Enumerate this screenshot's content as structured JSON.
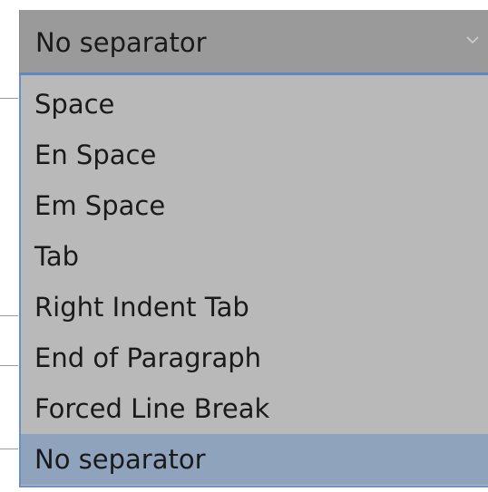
{
  "select": {
    "current_value": "No separator",
    "chevron_icon": "chevron-down-icon"
  },
  "dropdown": {
    "options": [
      {
        "label": "Space",
        "selected": false
      },
      {
        "label": "En Space",
        "selected": false
      },
      {
        "label": "Em Space",
        "selected": false
      },
      {
        "label": "Tab",
        "selected": false
      },
      {
        "label": "Right Indent Tab",
        "selected": false
      },
      {
        "label": "End of Paragraph",
        "selected": false
      },
      {
        "label": "Forced Line Break",
        "selected": false
      },
      {
        "label": "No separator",
        "selected": true
      }
    ]
  },
  "colors": {
    "select_bg": "#9a9a9a",
    "list_bg": "#b9b9b9",
    "selected_bg": "#8fa3bd",
    "focus_border": "#5f87c4"
  }
}
